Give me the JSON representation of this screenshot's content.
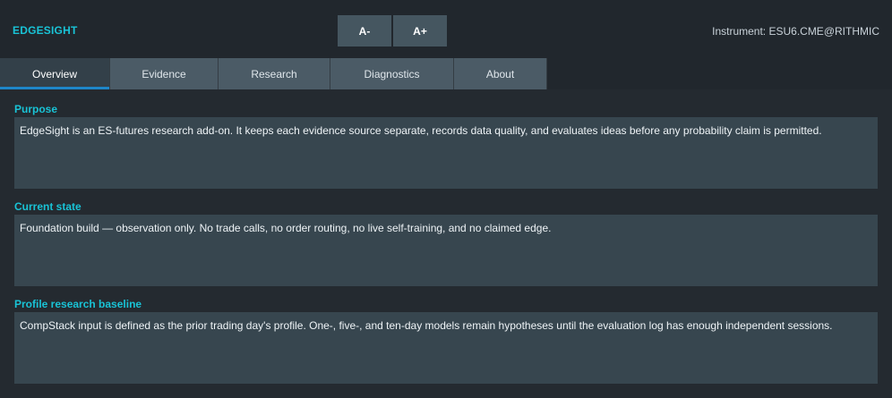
{
  "header": {
    "brand": "EDGESIGHT",
    "font_decrease_label": "A-",
    "font_increase_label": "A+",
    "instrument": "Instrument: ESU6.CME@RITHMIC"
  },
  "tabs": [
    {
      "label": "Overview",
      "active": true
    },
    {
      "label": "Evidence",
      "active": false
    },
    {
      "label": "Research",
      "active": false
    },
    {
      "label": "Diagnostics",
      "active": false
    },
    {
      "label": "About",
      "active": false
    }
  ],
  "sections": [
    {
      "title": "Purpose",
      "body": "EdgeSight is an ES-futures research add-on. It keeps each evidence source separate, records data quality, and evaluates ideas before any probability claim is permitted."
    },
    {
      "title": "Current state",
      "body": "Foundation build — observation only. No trade calls, no order routing, no live self-training, and no claimed edge."
    },
    {
      "title": "Profile research baseline",
      "body": "CompStack input is defined as the prior trading day's profile. One-, five-, and ten-day models remain hypotheses until the evaluation log has enough independent sessions."
    }
  ],
  "colors": {
    "accent": "#19c3d6",
    "tab_indicator": "#1e86c8",
    "panel": "#37464f",
    "background": "#242a30"
  }
}
